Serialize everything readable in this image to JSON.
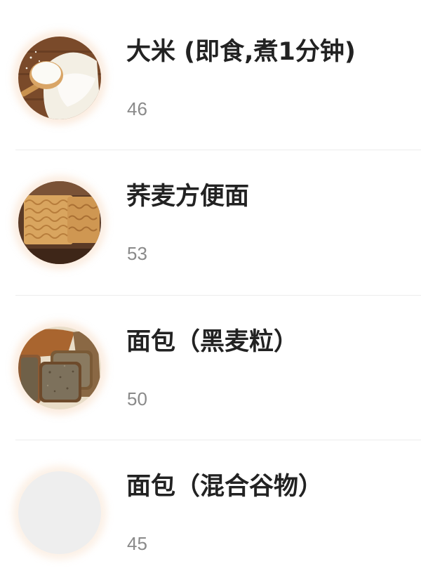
{
  "food_list": {
    "items": [
      {
        "name": "大米 (即食,煮1分钟)",
        "value": "46",
        "image_icon": "rice-photo-icon"
      },
      {
        "name": "荞麦方便面",
        "value": "53",
        "image_icon": "instant-noodles-photo-icon"
      },
      {
        "name": "面包（黑麦粒）",
        "value": "50",
        "image_icon": "rye-bread-photo-icon"
      },
      {
        "name": "面包（混合谷物）",
        "value": "45",
        "image_icon": "placeholder-image-icon"
      }
    ]
  },
  "colors": {
    "title_text": "#222222",
    "value_text": "#8a8a8a",
    "divider": "#ececec",
    "thumb_glow": "#f4ccaa",
    "placeholder_fill": "#eeeeee"
  }
}
